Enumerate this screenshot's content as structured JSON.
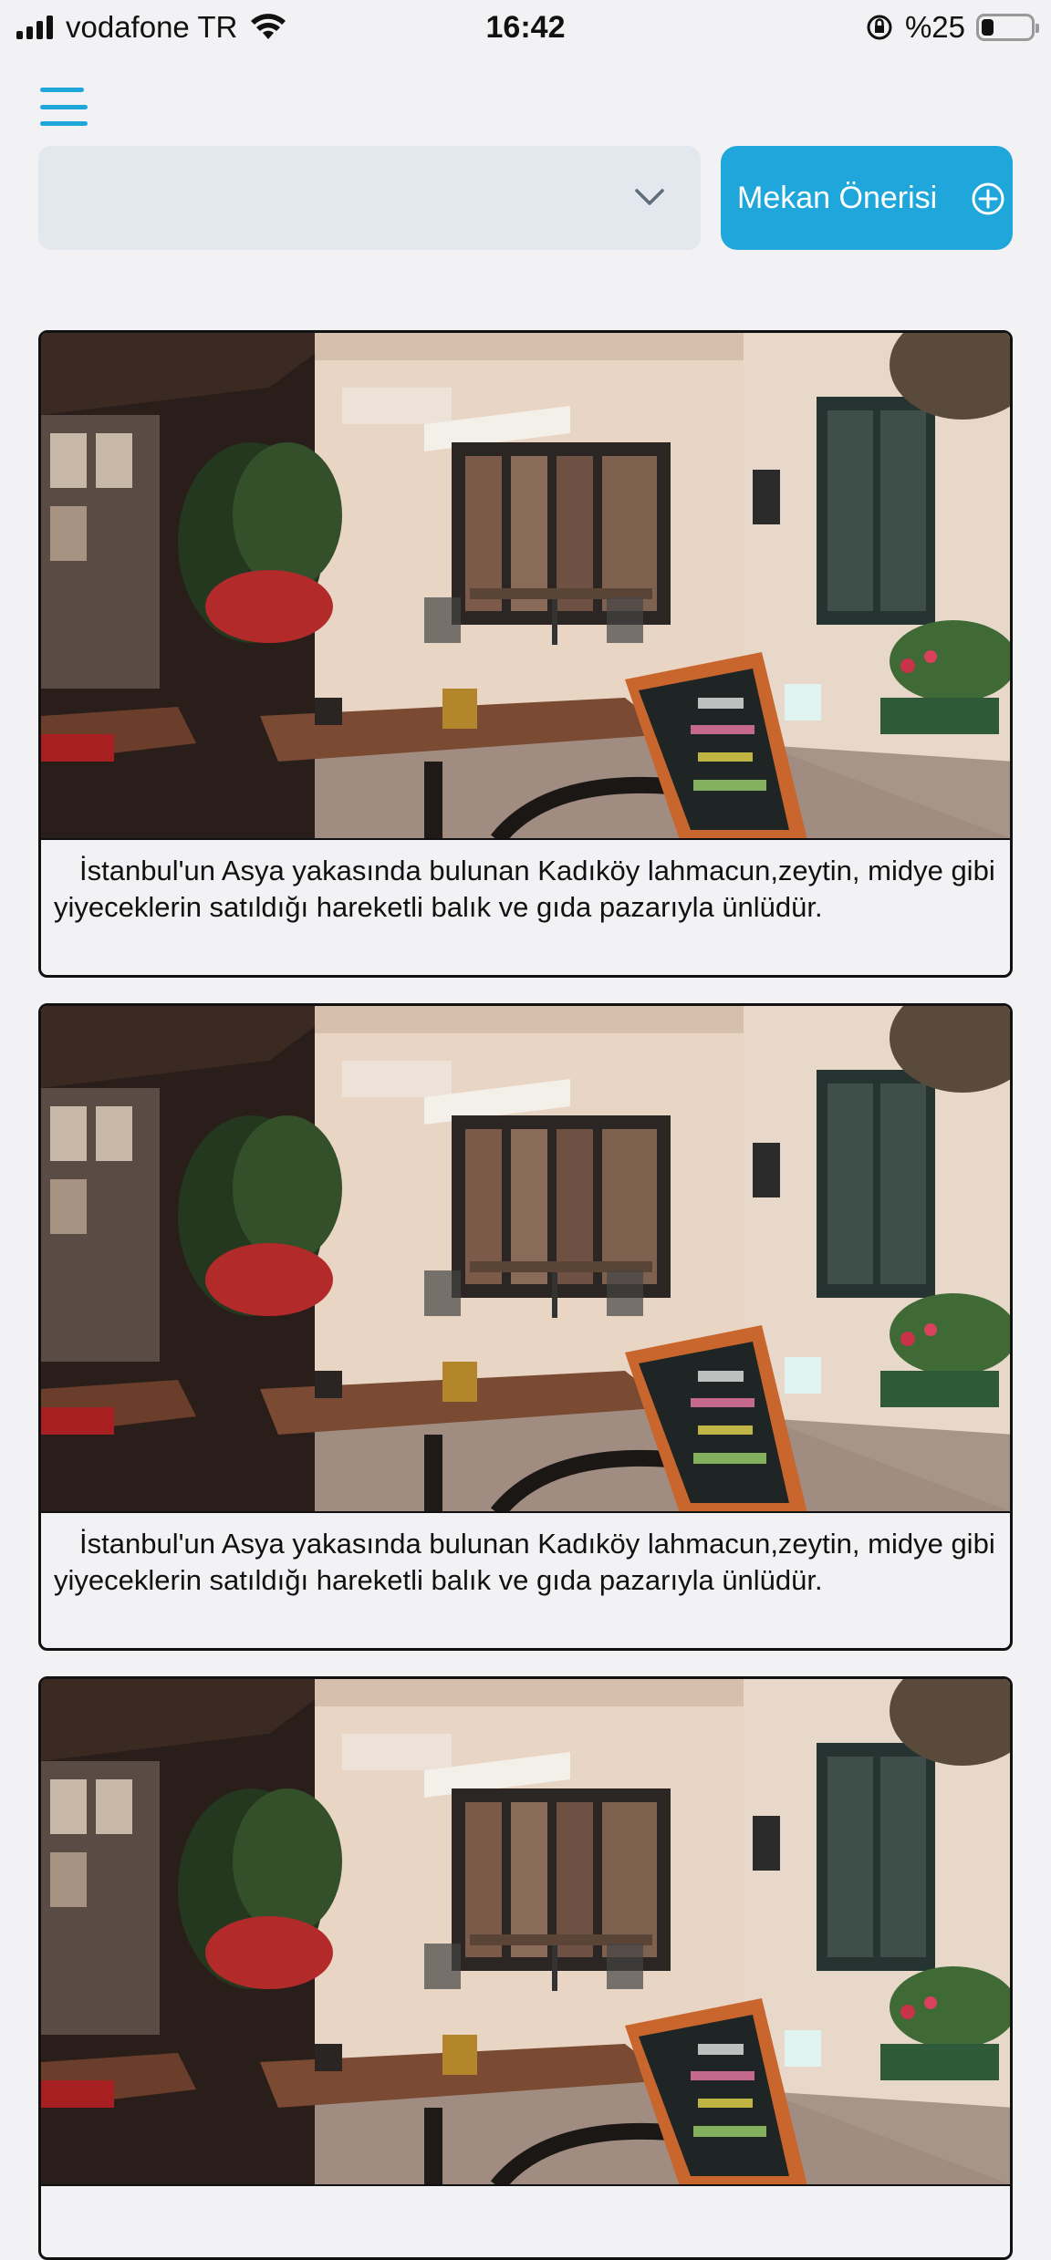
{
  "status_bar": {
    "carrier": "vodafone TR",
    "time": "16:42",
    "battery_percent": "%25",
    "battery_level": 0.25
  },
  "header": {
    "menu_icon": "hamburger-menu-icon",
    "select": {
      "value": "",
      "icon": "chevron-down-icon"
    },
    "suggest_button": {
      "label": "Mekan Önerisi",
      "icon": "plus-circle-icon"
    }
  },
  "colors": {
    "accent": "#1fa7dc",
    "select_bg": "#e3e8ef",
    "page_bg": "#f2f2f4"
  },
  "places": [
    {
      "image": "cafe-street-photo",
      "description": "İstanbul'un Asya yakasında bulunan Kadıköy lahmacun,zeytin, midye gibi yiyeceklerin satıldığı hareketli balık ve gıda pazarıyla ünlüdür."
    },
    {
      "image": "cafe-street-photo",
      "description": "İstanbul'un Asya yakasında bulunan Kadıköy lahmacun,zeytin, midye gibi yiyeceklerin satıldığı hareketli balık ve gıda pazarıyla ünlüdür."
    },
    {
      "image": "cafe-street-photo",
      "description": ""
    }
  ]
}
